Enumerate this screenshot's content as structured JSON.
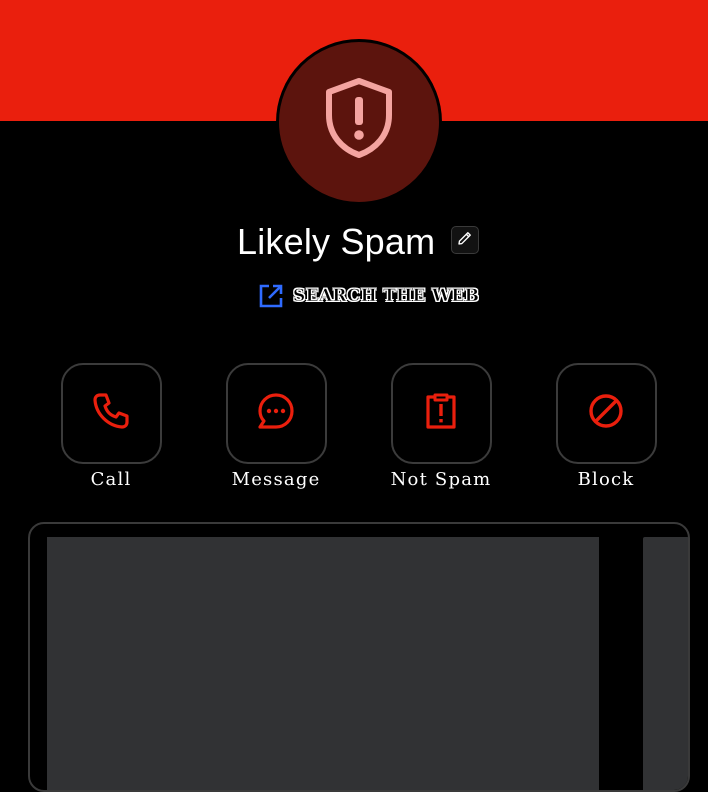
{
  "header": {
    "banner_color": "#ea1f0d",
    "avatar_icon": "shield-alert-icon",
    "avatar_bg": "#5c140d"
  },
  "contact": {
    "title": "Likely Spam",
    "edit_icon": "pencil-icon"
  },
  "search_web": {
    "icon": "external-link-icon",
    "label": "SEARCH THE WEB",
    "accent": "#2f6bff"
  },
  "actions": [
    {
      "label": "Call",
      "icon": "phone-icon"
    },
    {
      "label": "Message",
      "icon": "message-bubble-icon"
    },
    {
      "label": "Not Spam",
      "icon": "clipboard-alert-icon"
    },
    {
      "label": "Block",
      "icon": "block-icon"
    }
  ],
  "colors": {
    "action_icon": "#ea1f0d",
    "card": "#313234"
  }
}
